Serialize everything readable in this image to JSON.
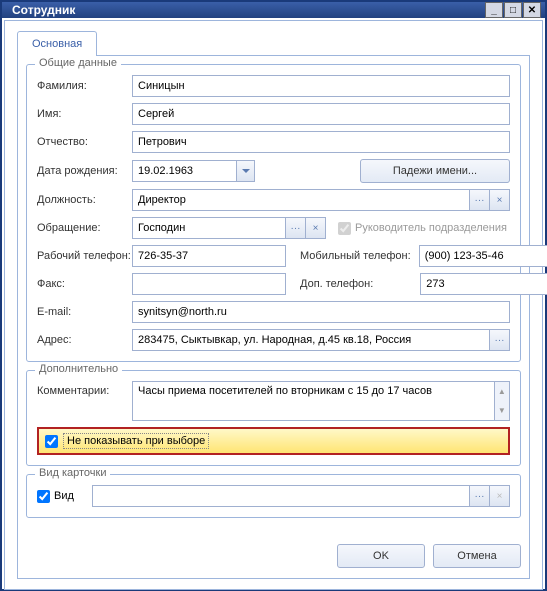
{
  "window": {
    "title": "Сотрудник"
  },
  "tabs": {
    "main": "Основная"
  },
  "groups": {
    "general": "Общие данные",
    "extra": "Дополнительно",
    "card": "Вид карточки"
  },
  "labels": {
    "lastname": "Фамилия:",
    "firstname": "Имя:",
    "middlename": "Отчество:",
    "birthdate": "Дата рождения:",
    "position": "Должность:",
    "salutation": "Обращение:",
    "workphone": "Рабочий телефон:",
    "mobile": "Мобильный телефон:",
    "fax": "Факс:",
    "addphone": "Доп. телефон:",
    "email": "E-mail:",
    "address": "Адрес:",
    "comments": "Комментарии:",
    "head": "Руководитель подразделения",
    "hide": "Не показывать при выборе",
    "view": "Вид"
  },
  "values": {
    "lastname": "Синицын",
    "firstname": "Сергей",
    "middlename": "Петрович",
    "birthdate": "19.02.1963",
    "position": "Директор",
    "salutation": "Господин",
    "workphone": "726-35-37",
    "mobile": "(900) 123-35-46",
    "fax": "",
    "addphone": "273",
    "email": "synitsyn@north.ru",
    "address": "283475, Сыктывкар, ул. Народная, д.45 кв.18, Россия",
    "comments": "Часы приема посетителей по вторникам с 15 до 17 часов",
    "view": ""
  },
  "buttons": {
    "cases": "Падежи имени...",
    "ok": "OK",
    "cancel": "Отмена",
    "dots": "···",
    "x": "×"
  },
  "checks": {
    "head": true,
    "hide": true,
    "view": true
  },
  "icons": {
    "min": "_",
    "max": "□",
    "close": "✕"
  }
}
